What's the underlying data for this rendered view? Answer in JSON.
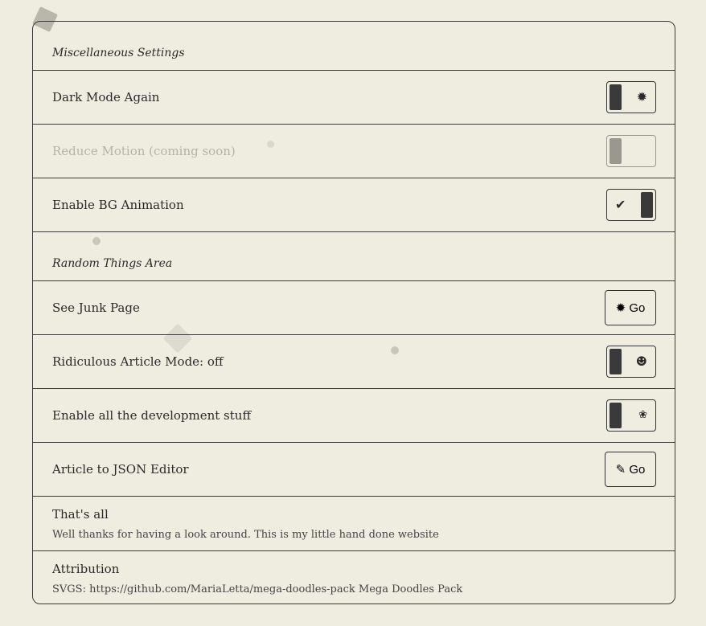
{
  "sections": [
    {
      "heading": "Miscellaneous Settings"
    },
    {
      "heading": "Random Things Area"
    }
  ],
  "items": {
    "dark_mode": {
      "label": "Dark Mode Again",
      "state": "off",
      "icon": "sun-icon"
    },
    "reduce_motion": {
      "label": "Reduce Motion (coming soon)",
      "state": "off",
      "disabled": true
    },
    "bg_animation": {
      "label": "Enable BG Animation",
      "state": "on",
      "icon": "check-icon"
    },
    "junk_page": {
      "label": "See Junk Page",
      "button": "Go",
      "icon": "sun-icon"
    },
    "ridiculous": {
      "label": "Ridiculous Article Mode: off",
      "state": "off",
      "icon": "smiley-icon"
    },
    "dev_stuff": {
      "label": "Enable all the development stuff",
      "state": "off",
      "icon": "doodle-icon"
    },
    "json_editor": {
      "label": "Article to JSON Editor",
      "button": "Go",
      "icon": "pencil-icon"
    }
  },
  "footer": {
    "thats_all_title": "That's all",
    "thats_all_text": "Well thanks for having a look around. This is my little hand done website",
    "attribution_title": "Attribution",
    "attribution_text": "SVGS: https://github.com/MariaLetta/mega-doodles-pack Mega Doodles Pack"
  }
}
